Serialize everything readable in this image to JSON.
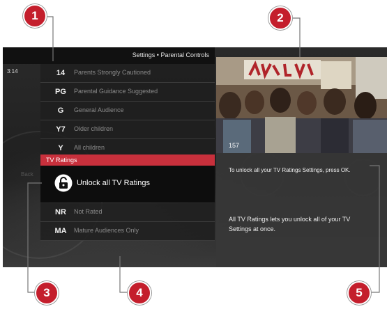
{
  "breadcrumb": "Settings • Parental Controls",
  "time": "3:14",
  "ratings_top": [
    {
      "icon": "TV-14",
      "icon_text": "14",
      "label": "Parents Strongly Cautioned"
    },
    {
      "icon": "TV-PG",
      "icon_text": "PG",
      "label": "Parental Guidance Suggested"
    },
    {
      "icon": "TV-G",
      "icon_text": "G",
      "label": "General Audience"
    },
    {
      "icon": "TV-Y7",
      "icon_text": "Y7",
      "label": "Older children"
    },
    {
      "icon": "TV-Y",
      "icon_text": "Y",
      "label": "All children"
    }
  ],
  "section_header": "TV Ratings",
  "selected_item": {
    "label": "Unlock all TV Ratings",
    "icon": "unlock-icon"
  },
  "ratings_bottom": [
    {
      "icon": "TV-NR",
      "icon_text": "NR",
      "label": "Not Rated"
    },
    {
      "icon": "TV-MA",
      "icon_text": "MA",
      "label": "Mature Audiences Only"
    }
  ],
  "video": {
    "channel_number": "157"
  },
  "info": {
    "unlock_message": "To unlock all your TV Ratings Settings, press OK.",
    "description": "All TV Ratings lets you unlock all of your TV Settings at once."
  },
  "back_label": "Back",
  "callouts": [
    "1",
    "2",
    "3",
    "4",
    "5"
  ],
  "colors": {
    "accent": "#c8303c",
    "callout": "#c41e2c"
  }
}
